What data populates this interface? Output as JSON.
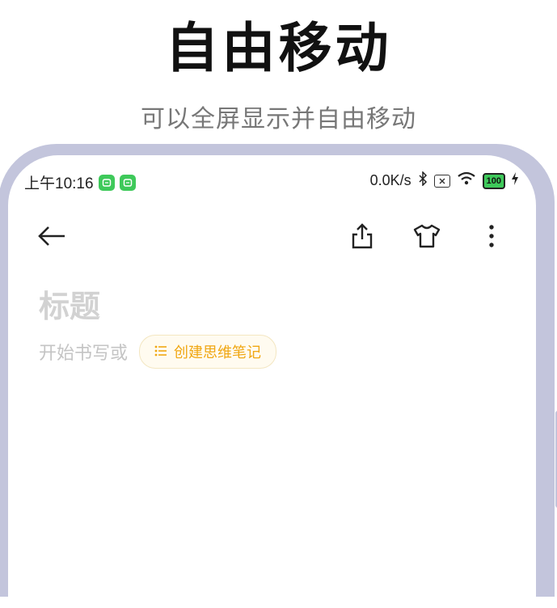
{
  "headline": {
    "title": "自由移动",
    "subtitle": "可以全屏显示并自由移动"
  },
  "status_bar": {
    "time": "上午10:16",
    "network_speed": "0.0K/s",
    "battery": "100",
    "icons": [
      "app-notification-icon",
      "app-notification-icon",
      "bluetooth-icon",
      "sim-icon",
      "wifi-icon",
      "battery-icon",
      "charging-icon"
    ]
  },
  "app_bar": {
    "icons": [
      "back-arrow-icon",
      "share-icon",
      "theme-shirt-icon",
      "more-vertical-icon"
    ]
  },
  "note": {
    "title_placeholder": "标题",
    "body_placeholder": "开始书写或",
    "mind_map_button": "创建思维笔记"
  },
  "colors": {
    "frame": "#c3c5dc",
    "accent": "#f0a712",
    "accent_bg": "#fffbf0",
    "status_app": "#3ec95a"
  }
}
